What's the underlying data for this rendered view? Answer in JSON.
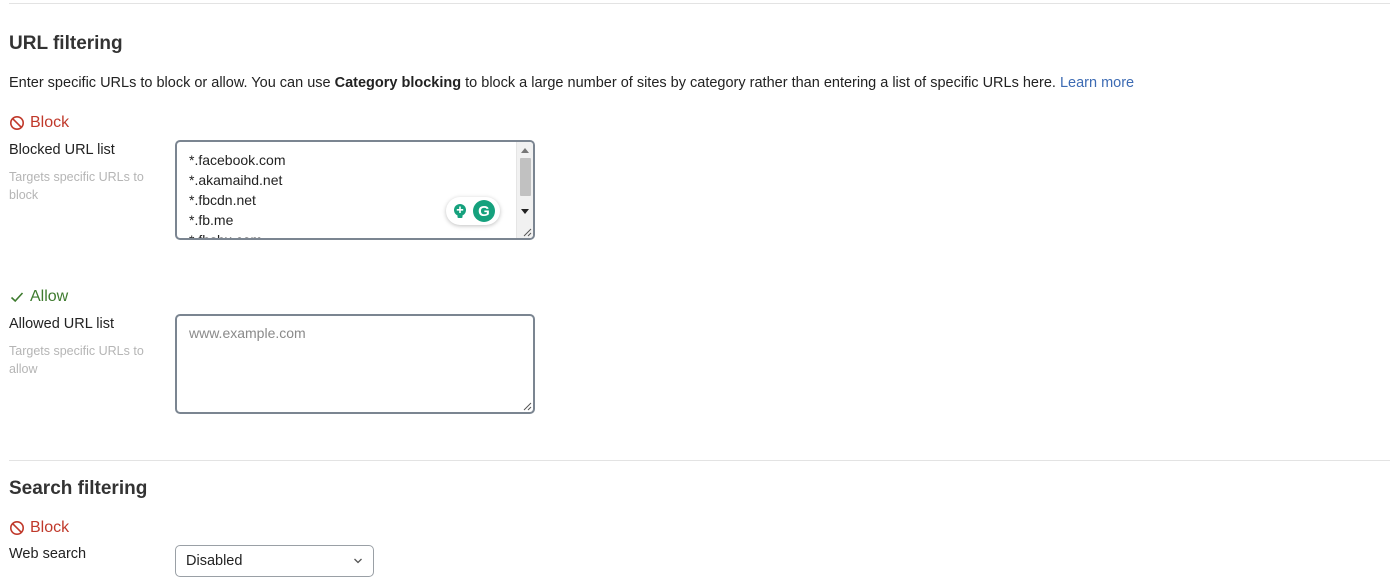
{
  "url_filtering": {
    "heading": "URL filtering",
    "description_pre": "Enter specific URLs to block or allow. You can use ",
    "description_bold": "Category blocking",
    "description_post": " to block a large number of sites by category rather than entering a list of specific URLs here.",
    "learn_more": "Learn more",
    "block": {
      "status_label": "Block",
      "field_label": "Blocked URL list",
      "hint": "Targets specific URLs to block",
      "lines": [
        "*.facebook.com",
        "*.akamaihd.net",
        "*.fbcdn.net",
        "*.fb.me",
        "*.fbsbx.com"
      ]
    },
    "allow": {
      "status_label": "Allow",
      "field_label": "Allowed URL list",
      "hint": "Targets specific URLs to allow",
      "placeholder": "www.example.com"
    }
  },
  "search_filtering": {
    "heading": "Search filtering",
    "block_status": "Block",
    "web_search_label": "Web search",
    "web_search_value": "Disabled"
  },
  "colors": {
    "block": "#c0392b",
    "allow": "#3e7b2e",
    "link": "#3d6bb3",
    "grammarly": "#15a17d"
  },
  "icons": {
    "block": "prohibited-icon",
    "allow": "checkmark-icon",
    "assistant": "grammarly-icon"
  }
}
